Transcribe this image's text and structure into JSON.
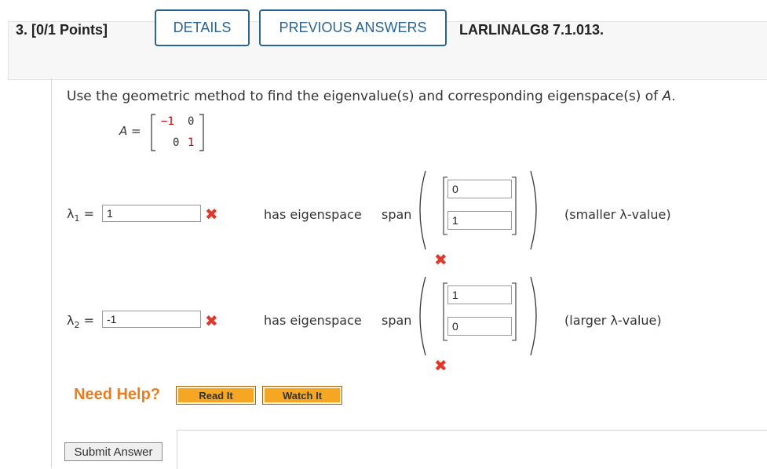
{
  "question": {
    "label": "3. [0/1 Points]",
    "details_label": "DETAILS",
    "previous_answers_label": "PREVIOUS ANSWERS",
    "code": "LARLINALG8 7.1.013."
  },
  "prompt": {
    "text": "Use the geometric method to find the eigenvalue(s) and corresponding eigenspace(s) of ",
    "var": "A",
    "end": "."
  },
  "matrix": {
    "label": "A =",
    "rows": [
      [
        "−1",
        "0"
      ],
      [
        "0",
        "1"
      ]
    ],
    "highlight_color": "#cc0000"
  },
  "answers": [
    {
      "lambda_symbol": "λ",
      "lambda_sub": "1",
      "equals": "=",
      "value": "1",
      "status": "incorrect",
      "has_eigenspace": "has eigenspace",
      "span": "span",
      "vector": [
        "0",
        "1"
      ],
      "note": "(smaller λ-value)"
    },
    {
      "lambda_symbol": "λ",
      "lambda_sub": "2",
      "equals": "=",
      "value": "-1",
      "status": "incorrect",
      "has_eigenspace": "has eigenspace",
      "span": "span",
      "vector": [
        "1",
        "0"
      ],
      "note": "(larger λ-value)"
    }
  ],
  "help": {
    "label": "Need Help?",
    "read_it": "Read It",
    "watch_it": "Watch It"
  },
  "submit_label": "Submit Answer",
  "colors": {
    "accent": "#2a6496",
    "incorrect": "#e0392b",
    "help": "#e67e22",
    "help_button": "#f5a623"
  },
  "icons": {
    "incorrect": "x-mark-icon"
  }
}
